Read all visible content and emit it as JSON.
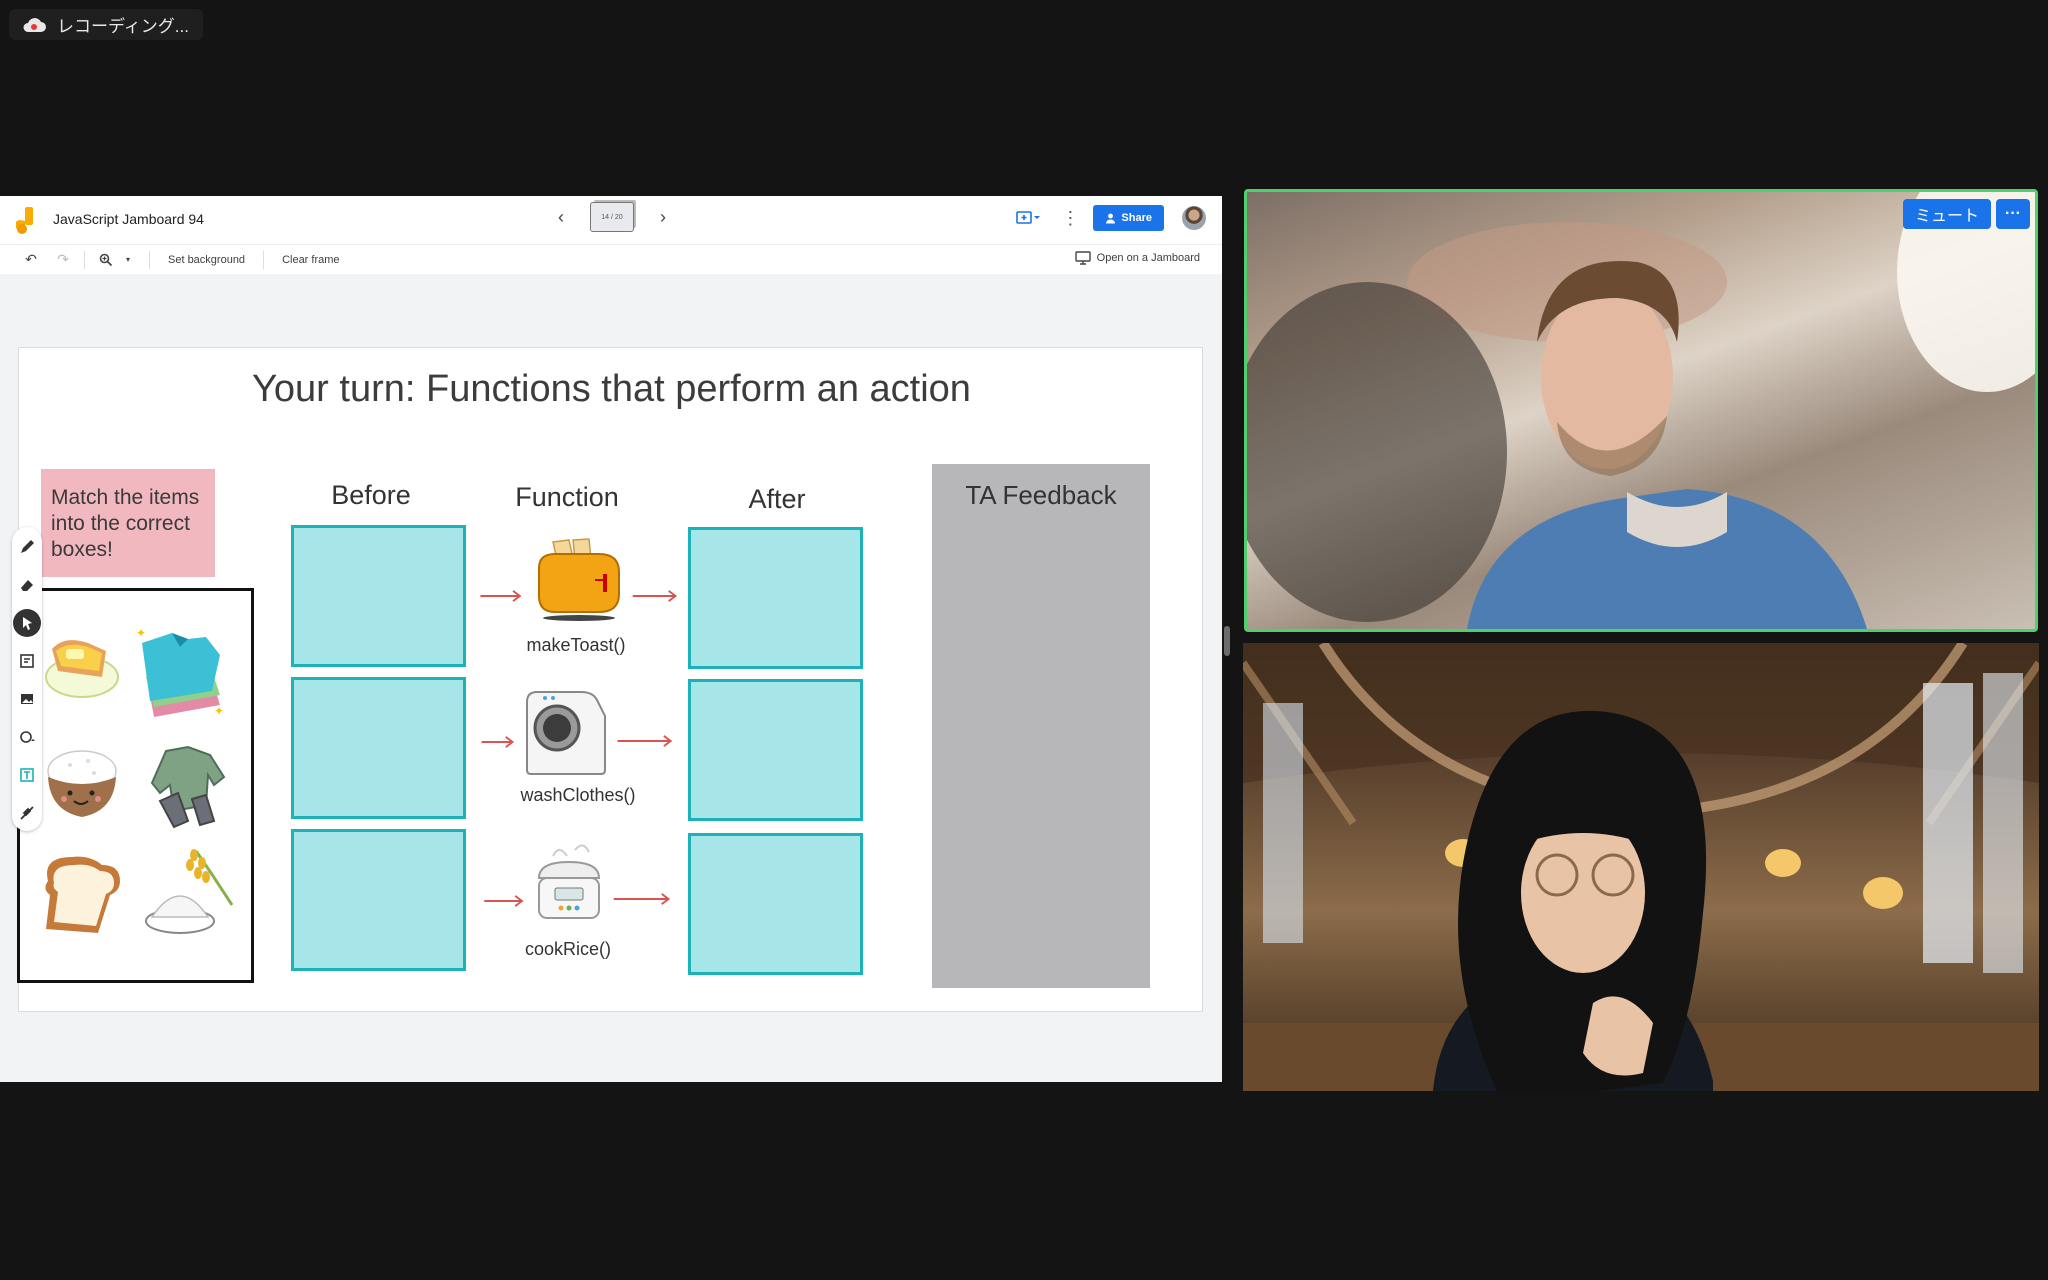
{
  "recording": {
    "label": "レコーディング..."
  },
  "jamboard": {
    "title": "JavaScript Jamboard 94",
    "frame_counter": "14 / 20",
    "share_label": "Share",
    "toolbar": {
      "set_background": "Set background",
      "clear_frame": "Clear frame",
      "open_on_jamboard": "Open on a Jamboard"
    },
    "slide": {
      "title": "Your turn: Functions that perform an action",
      "sticky_note": "Match the items into the correct boxes!",
      "columns": {
        "before": "Before",
        "function": "Function",
        "after": "After"
      },
      "functions": [
        "makeToast()",
        "washClothes()",
        "cookRice()"
      ],
      "ta_feedback": "TA Feedback"
    }
  },
  "video_tiles": [
    {
      "role": "active-speaker",
      "controls": {
        "mute": "ミュート",
        "more": "···"
      }
    },
    {
      "role": "participant"
    }
  ],
  "colors": {
    "speaker_border": "#4fd06a",
    "accent_blue": "#1a73e8",
    "target_box_fill": "#a6e6e8",
    "target_box_border": "#1cb3b8",
    "sticky_pink": "#f2b8c0",
    "feedback_gray": "#b7b7b9"
  }
}
